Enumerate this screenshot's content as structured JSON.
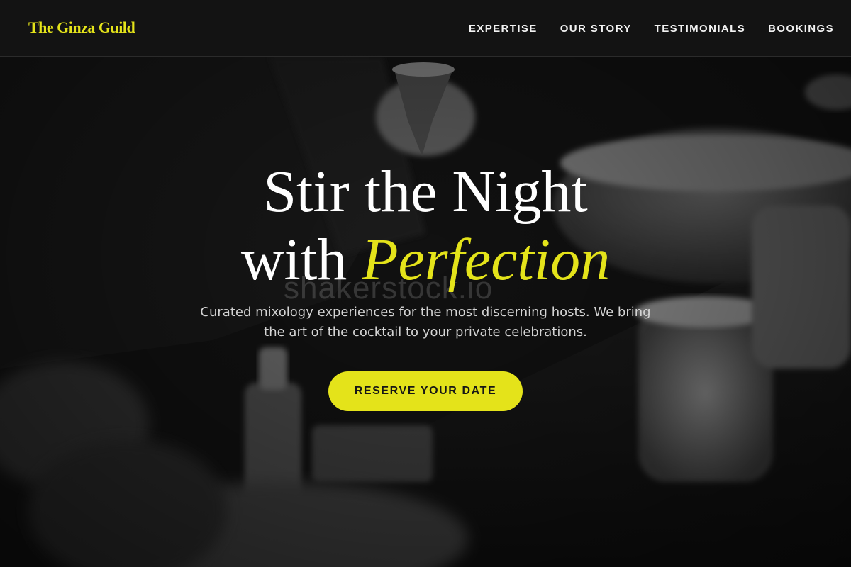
{
  "brand": {
    "name": "The Ginza Guild",
    "accent_color": "#e4e31a"
  },
  "nav": {
    "items": [
      {
        "label": "EXPERTISE"
      },
      {
        "label": "OUR STORY"
      },
      {
        "label": "TESTIMONIALS"
      },
      {
        "label": "BOOKINGS"
      }
    ]
  },
  "hero": {
    "title_line1": "Stir the Night",
    "title_line2_plain": "with ",
    "title_line2_accent": "Perfection",
    "subtitle": "Curated mixology experiences for the most discerning hosts. We bring the art of the cocktail to your private celebrations.",
    "cta_label": "RESERVE YOUR DATE",
    "background_image": "black-and-white-bartender-cocktail-bar",
    "watermark": "shakerstock.io"
  }
}
